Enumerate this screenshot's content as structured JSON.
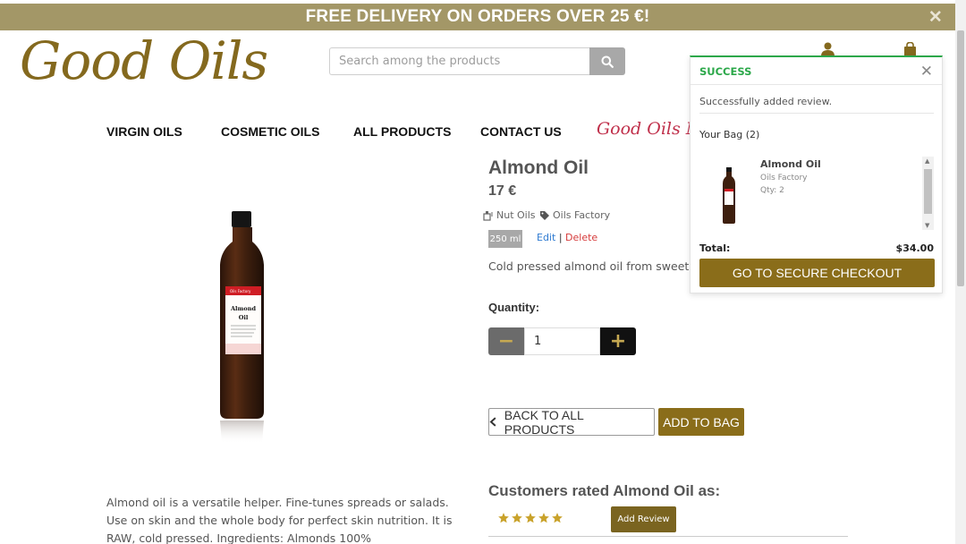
{
  "banner": {
    "text": "FREE DELIVERY ON ORDERS OVER 25 €!",
    "close": "✕"
  },
  "logo": {
    "text": "Good Oils"
  },
  "search": {
    "placeholder": "Search among the products"
  },
  "nav": {
    "items": [
      "VIRGIN OILS",
      "COSMETIC OILS",
      "ALL PRODUCTS",
      "CONTACT US"
    ],
    "magazine": "Good Oils Magazine"
  },
  "product": {
    "title": "Almond Oil",
    "price": "17 €",
    "category": "Nut Oils",
    "brand": "Oils Factory",
    "size": "250 ml",
    "edit": "Edit",
    "separator": "|",
    "delete": "Delete",
    "short_description": "Cold pressed almond oil from sweet almonds",
    "quantity_label": "Quantity:",
    "quantity_value": "1",
    "minus": "−",
    "plus": "+",
    "back_button": "BACK TO ALL PRODUCTS",
    "add_to_bag": "ADD TO BAG",
    "bottle_label_brand": "Oils Factory",
    "bottle_label_name_1": "Almond",
    "bottle_label_name_2": "Oil",
    "long_description": "Almond oil is a versatile helper. Fine-tunes spreads or salads. Use on skin and the whole body for perfect skin nutrition. It is RAW, cold pressed. Ingredients: Almonds 100%"
  },
  "reviews": {
    "heading": "Customers rated Almond Oil as:",
    "rating_stars": 5,
    "add_review": "Add Review"
  },
  "toast": {
    "heading": "SUCCESS",
    "close": "✕",
    "message": "Successfully added review.",
    "bag_title": "Your Bag (2)",
    "item_name": "Almond Oil",
    "item_brand": "Oils Factory",
    "item_qty": "Qty: 2",
    "total_label": "Total:",
    "total_value": "$34.00",
    "checkout": "GO TO SECURE CHECKOUT"
  },
  "colors": {
    "banner": "#a39767",
    "brand": "#84691e",
    "button": "#8a6d1a",
    "success": "#2ca84a",
    "star": "#c9a22b",
    "magazine": "#c0304b"
  }
}
